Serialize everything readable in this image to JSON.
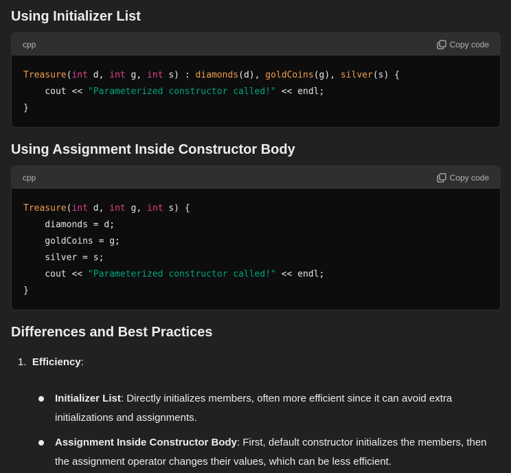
{
  "sections": [
    {
      "heading": "Using Initializer List",
      "lang": "cpp",
      "copy_label": "Copy code"
    },
    {
      "heading": "Using Assignment Inside Constructor Body",
      "lang": "cpp",
      "copy_label": "Copy code"
    }
  ],
  "code1": {
    "line1_fn": "Treasure",
    "line1_a": "(",
    "line1_kw1": "int",
    "line1_b": " d, ",
    "line1_kw2": "int",
    "line1_c": " g, ",
    "line1_kw3": "int",
    "line1_d": " s) : ",
    "line1_fn2": "diamonds",
    "line1_e": "(d), ",
    "line1_fn3": "goldCoins",
    "line1_f": "(g), ",
    "line1_fn4": "silver",
    "line1_g": "(s) {",
    "line2_a": "    cout << ",
    "line2_str": "\"Parameterized constructor called!\"",
    "line2_b": " << endl;",
    "line3": "}"
  },
  "code2": {
    "line1_fn": "Treasure",
    "line1_a": "(",
    "line1_kw1": "int",
    "line1_b": " d, ",
    "line1_kw2": "int",
    "line1_c": " g, ",
    "line1_kw3": "int",
    "line1_d": " s) {",
    "line2": "    diamonds = d;",
    "line3": "    goldCoins = g;",
    "line4": "    silver = s;",
    "line5_a": "    cout << ",
    "line5_str": "\"Parameterized constructor called!\"",
    "line5_b": " << endl;",
    "line6": "}"
  },
  "differences": {
    "heading": "Differences and Best Practices",
    "item1_num": "1.",
    "item1_title": "Efficiency",
    "item1_colon": ":",
    "bullet1_title": "Initializer List",
    "bullet1_text": ": Directly initializes members, often more efficient since it can avoid extra initializations and assignments.",
    "bullet2_title": "Assignment Inside Constructor Body",
    "bullet2_text": ": First, default constructor initializes the members, then the assignment operator changes their values, which can be less efficient."
  }
}
